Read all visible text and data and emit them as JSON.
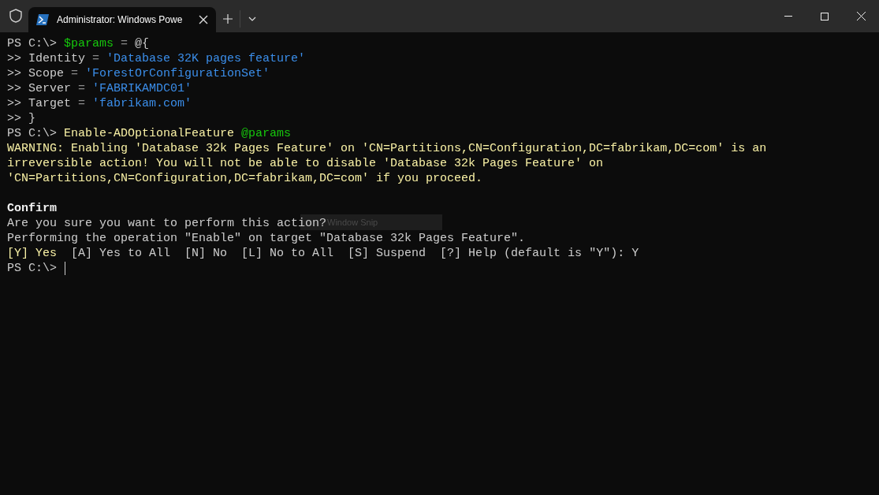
{
  "window": {
    "tab_title": "Administrator: Windows Powe"
  },
  "terminal": {
    "lines": [
      {
        "segments": [
          {
            "kind": "plain",
            "text": "PS C:\\> "
          },
          {
            "kind": "variable",
            "text": "$params"
          },
          {
            "kind": "operator",
            "text": " = "
          },
          {
            "kind": "plain",
            "text": "@{"
          }
        ]
      },
      {
        "segments": [
          {
            "kind": "plain",
            "text": ">> Identity "
          },
          {
            "kind": "operator",
            "text": "= "
          },
          {
            "kind": "string",
            "text": "'Database 32K pages feature'"
          }
        ]
      },
      {
        "segments": [
          {
            "kind": "plain",
            "text": ">> Scope "
          },
          {
            "kind": "operator",
            "text": "= "
          },
          {
            "kind": "string",
            "text": "'ForestOrConfigurationSet'"
          }
        ]
      },
      {
        "segments": [
          {
            "kind": "plain",
            "text": ">> Server "
          },
          {
            "kind": "operator",
            "text": "= "
          },
          {
            "kind": "string",
            "text": "'FABRIKAMDC01'"
          }
        ]
      },
      {
        "segments": [
          {
            "kind": "plain",
            "text": ">> Target "
          },
          {
            "kind": "operator",
            "text": "= "
          },
          {
            "kind": "string",
            "text": "'fabrikam.com'"
          }
        ]
      },
      {
        "segments": [
          {
            "kind": "plain",
            "text": ">> }"
          }
        ]
      },
      {
        "segments": [
          {
            "kind": "plain",
            "text": "PS C:\\> "
          },
          {
            "kind": "command",
            "text": "Enable-ADOptionalFeature "
          },
          {
            "kind": "variable",
            "text": "@params"
          }
        ]
      },
      {
        "segments": [
          {
            "kind": "warning",
            "text": "WARNING: Enabling 'Database 32k Pages Feature' on 'CN=Partitions,CN=Configuration,DC=fabrikam,DC=com' is an"
          }
        ]
      },
      {
        "segments": [
          {
            "kind": "warning",
            "text": "irreversible action! You will not be able to disable 'Database 32k Pages Feature' on"
          }
        ]
      },
      {
        "segments": [
          {
            "kind": "warning",
            "text": "'CN=Partitions,CN=Configuration,DC=fabrikam,DC=com' if you proceed."
          }
        ]
      },
      {
        "kind": "blank"
      },
      {
        "segments": [
          {
            "kind": "heading",
            "text": "Confirm"
          }
        ]
      },
      {
        "segments": [
          {
            "kind": "plain",
            "text": "Are you sure you want to perform this action?"
          }
        ]
      },
      {
        "segments": [
          {
            "kind": "plain",
            "text": "Performing the operation \"Enable\" on target \"Database 32k Pages Feature\"."
          }
        ]
      },
      {
        "segments": [
          {
            "kind": "command",
            "text": "[Y] Yes"
          },
          {
            "kind": "plain",
            "text": "  [A] Yes to All  [N] No  [L] No to All  [S] Suspend  [?] Help (default is \"Y\"): Y"
          }
        ]
      },
      {
        "segments": [
          {
            "kind": "plain",
            "text": "PS C:\\> "
          }
        ],
        "cursor": true
      }
    ]
  },
  "overlay": {
    "label": "Window Snip"
  }
}
